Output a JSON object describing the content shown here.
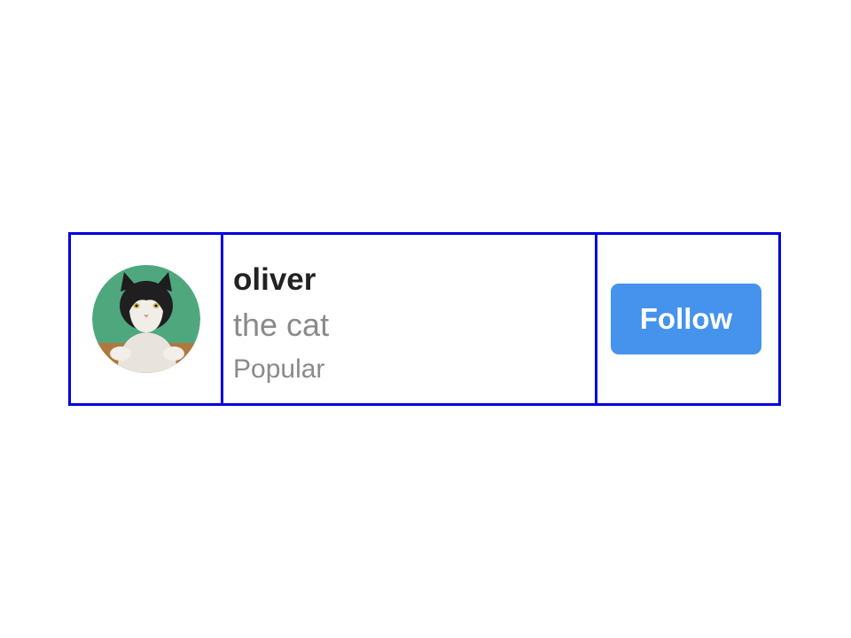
{
  "profile": {
    "name": "oliver",
    "subtitle": "the cat",
    "tag": "Popular"
  },
  "actions": {
    "follow_label": "Follow"
  },
  "colors": {
    "border": "#0000dd",
    "button": "#4593ec",
    "name_text": "#222222",
    "secondary_text": "#8a8a8a"
  },
  "icons": {
    "avatar": "cat-photo-avatar"
  }
}
